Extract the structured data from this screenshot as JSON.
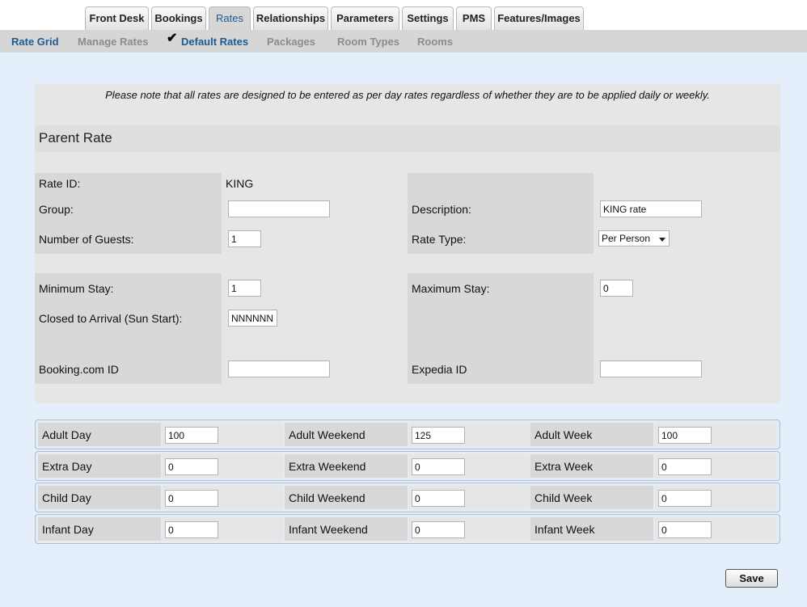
{
  "tabs": [
    {
      "label": "Front Desk"
    },
    {
      "label": "Bookings"
    },
    {
      "label": "Rates"
    },
    {
      "label": "Relationships"
    },
    {
      "label": "Parameters"
    },
    {
      "label": "Settings"
    },
    {
      "label": "PMS"
    },
    {
      "label": "Features/Images"
    }
  ],
  "active_tab": "Rates",
  "subnav": [
    {
      "label": "Rate Grid"
    },
    {
      "label": "Manage Rates"
    },
    {
      "label": "Default Rates"
    },
    {
      "label": "Packages"
    },
    {
      "label": "Room Types"
    },
    {
      "label": "Rooms"
    }
  ],
  "active_subnav": "Default Rates",
  "note": "Please note that all rates are designed to be entered as per day rates regardless of whether they are to be applied daily or weekly.",
  "section_title": "Parent Rate",
  "form": {
    "rate_id_label": "Rate ID:",
    "rate_id_value": "KING",
    "group_label": "Group:",
    "group_value": "",
    "description_label": "Description:",
    "description_value": "KING rate",
    "guests_label": "Number of Guests:",
    "guests_value": "1",
    "rate_type_label": "Rate Type:",
    "rate_type_value": "Per Person",
    "min_stay_label": "Minimum Stay:",
    "min_stay_value": "1",
    "max_stay_label": "Maximum Stay:",
    "max_stay_value": "0",
    "cta_label": "Closed to Arrival (Sun Start):",
    "cta_value": "NNNNNN",
    "booking_id_label": "Booking.com ID",
    "booking_id_value": "",
    "expedia_id_label": "Expedia ID",
    "expedia_id_value": ""
  },
  "rates": [
    {
      "day_label": "Adult Day",
      "day_value": "100",
      "weekend_label": "Adult Weekend",
      "weekend_value": "125",
      "week_label": "Adult Week",
      "week_value": "100"
    },
    {
      "day_label": "Extra Day",
      "day_value": "0",
      "weekend_label": "Extra Weekend",
      "weekend_value": "0",
      "week_label": "Extra Week",
      "week_value": "0"
    },
    {
      "day_label": "Child Day",
      "day_value": "0",
      "weekend_label": "Child Weekend",
      "weekend_value": "0",
      "week_label": "Child Week",
      "week_value": "0"
    },
    {
      "day_label": "Infant Day",
      "day_value": "0",
      "weekend_label": "Infant Weekend",
      "weekend_value": "0",
      "week_label": "Infant Week",
      "week_value": "0"
    }
  ],
  "save_label": "Save",
  "colors": {
    "page_bg": "#e5effc",
    "link_active": "#1d5a92",
    "panel": "#e6e6e6",
    "label_cell": "#d8d8d8"
  }
}
